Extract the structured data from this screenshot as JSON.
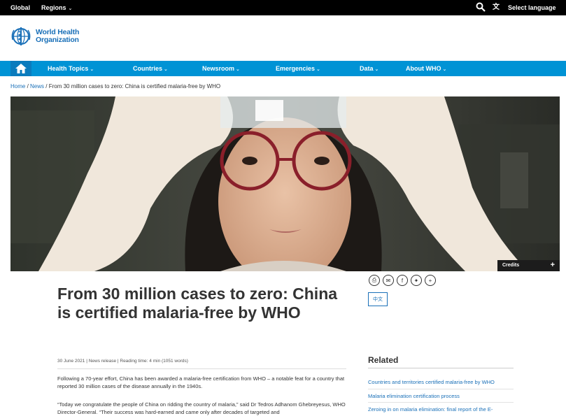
{
  "topbar": {
    "global": "Global",
    "regions": "Regions",
    "select_language": "Select language"
  },
  "logo": {
    "line1": "World Health",
    "line2": "Organization"
  },
  "nav": {
    "items": [
      {
        "label": "Health Topics"
      },
      {
        "label": "Countries"
      },
      {
        "label": "Newsroom"
      },
      {
        "label": "Emergencies"
      },
      {
        "label": "Data"
      },
      {
        "label": "About WHO"
      }
    ]
  },
  "breadcrumb": {
    "home": "Home",
    "sep1": " / ",
    "news": "News",
    "sep2": " / ",
    "current": "From 30 million cases to zero: China is certified malaria-free by WHO"
  },
  "hero": {
    "credits": "Credits"
  },
  "share": {
    "lang_button": "中文"
  },
  "article": {
    "title": "From 30 million cases to zero: China is certified malaria-free by WHO",
    "meta": "30 June 2021 | News release | Reading time: 4 min (1051 words)",
    "p1": "Following a 70-year effort, China has been awarded a malaria-free certification from WHO – a notable feat for a country that reported 30 million cases of the disease annually in the 1940s.",
    "p2": "“Today we congratulate the people of China on ridding the country of malaria,” said Dr Tedros Adhanom Ghebreyesus, WHO Director-General. “Their success was hard-earned and came only after decades of targeted and"
  },
  "related": {
    "title": "Related",
    "links": [
      "Countries and territories certified malaria-free by WHO",
      "Malaria elimination certification process",
      "Zeroing in on malaria elimination: final report of the E-"
    ]
  },
  "colors": {
    "nav_blue": "#0093d5",
    "link_blue": "#1a70b8",
    "topbar": "#000000"
  }
}
